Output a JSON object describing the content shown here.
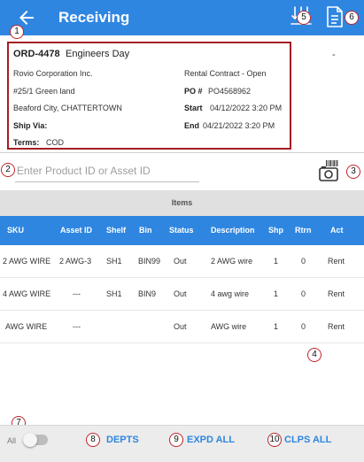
{
  "header": {
    "title": "Receiving",
    "back_icon": "arrow-left-icon",
    "ship_icon": "ship-all-icon",
    "document_icon": "document-icon"
  },
  "order": {
    "id": "ORD-4478",
    "name": "Engineers Day",
    "customer": "Rovio Corporation Inc.",
    "address1": "#25/1 Green land",
    "address2": "Beaford City, CHATTERTOWN",
    "ship_via_label": "Ship Via:",
    "ship_via_value": "",
    "terms_label": "Terms:",
    "terms_value": "COD",
    "contract": "Rental Contract - Open",
    "po_label": "PO #",
    "po_value": "PO4568962",
    "start_label": "Start",
    "start_value": "04/12/2022 3:20 PM",
    "end_label": "End",
    "end_value": "04/21/2022 3:20 PM",
    "right_dash": "-"
  },
  "search": {
    "placeholder": "Enter Product ID or Asset ID",
    "value": "",
    "scan_icon": "barcode-camera-icon"
  },
  "items": {
    "title": "Items",
    "columns": [
      "SKU",
      "Asset ID",
      "Shelf",
      "Bin",
      "Status",
      "Description",
      "Shp",
      "Rtrn",
      "Act"
    ],
    "rows": [
      [
        "2 AWG WIRE",
        "2 AWG-3",
        "SH1",
        "BIN99",
        "Out",
        "2 AWG wire",
        "1",
        "0",
        "Rent"
      ],
      [
        "4 AWG WIRE",
        "---",
        "SH1",
        "BIN9",
        "Out",
        "4 awg wire",
        "1",
        "0",
        "Rent"
      ],
      [
        "AWG WIRE",
        "---",
        "",
        "",
        "Out",
        "AWG wire",
        "1",
        "0",
        "Rent"
      ]
    ]
  },
  "footer": {
    "all_label": "All",
    "toggle_on": false,
    "depts_label": "DEPTS",
    "expd_all_label": "EXPD ALL",
    "clps_all_label": "CLPS ALL"
  },
  "callouts": [
    "1",
    "2",
    "3",
    "4",
    "5",
    "6",
    "7",
    "8",
    "9",
    "10"
  ],
  "colors": {
    "primary": "#2f86e0",
    "highlight_border": "#a51d24",
    "callout_border": "#c0242c",
    "items_bar": "#e0e0e0",
    "footer": "#ececec"
  }
}
